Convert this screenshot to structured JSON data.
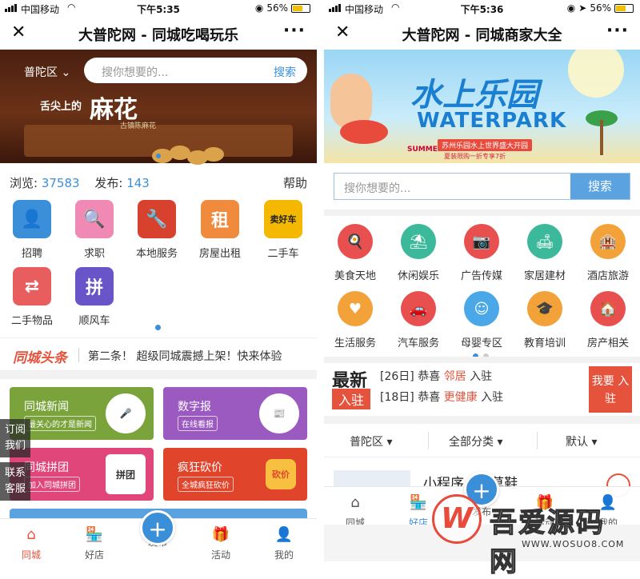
{
  "left": {
    "status": {
      "carrier": "中国移动",
      "time": "下午5:35",
      "battery": "56%"
    },
    "title": "大普陀网 - 同城吃喝玩乐",
    "banner": {
      "district": "普陀区 ⌄",
      "search_placeholder": "搜你想要的...",
      "search_btn": "搜索",
      "slogan": "舌尖上的",
      "product": "麻花",
      "sub": "古镇陈麻花"
    },
    "stats": {
      "views_label": "浏览:",
      "views": "37583",
      "posts_label": "发布:",
      "posts": "143",
      "help": "帮助"
    },
    "categories": [
      {
        "label": "招聘",
        "icon": "👤",
        "color": "#3b8fd8"
      },
      {
        "label": "求职",
        "icon": "🔍",
        "color": "#f08ab5"
      },
      {
        "label": "本地服务",
        "icon": "🔧",
        "color": "#d9412f"
      },
      {
        "label": "房屋出租",
        "icon": "租",
        "color": "#f08a3c"
      },
      {
        "label": "二手车",
        "icon": "卖好车",
        "color": "#f5b800"
      },
      {
        "label": "二手物品",
        "icon": "⇄",
        "color": "#e85d5d"
      },
      {
        "label": "顺风车",
        "icon": "拼",
        "color": "#6a55c8"
      }
    ],
    "headline": {
      "logo": "同城头条",
      "text": "第二条！ 超级同城震撼上架！快来体验"
    },
    "cards": [
      {
        "title": "同城新闻",
        "sub": "最关心的才是新闻",
        "icon": "🎤",
        "color": "#7aa33b"
      },
      {
        "title": "数字报",
        "sub": "在线看报",
        "icon": "📰",
        "color": "#9b5ac0"
      },
      {
        "title": "同城拼团",
        "sub": "加入同城拼团",
        "icon": "拼团",
        "color": "#e0467a"
      },
      {
        "title": "疯狂砍价",
        "sub": "全城疯狂砍价",
        "icon": "砍价",
        "color": "#e0452c"
      }
    ],
    "side": [
      {
        "text": "订阅 我们"
      },
      {
        "text": "联系 客服"
      }
    ],
    "tabs": [
      {
        "label": "同城",
        "icon": "⌂"
      },
      {
        "label": "好店",
        "icon": "🏪"
      },
      {
        "label": "发布",
        "icon": "+"
      },
      {
        "label": "活动",
        "icon": "🎁"
      },
      {
        "label": "我的",
        "icon": "👤"
      }
    ]
  },
  "right": {
    "status": {
      "carrier": "中国移动",
      "time": "下午5:36",
      "battery": "56%"
    },
    "title": "大普陀网 - 同城商家大全",
    "banner": {
      "t1": "水上乐园",
      "t2": "WATERPARK",
      "t3": "苏州乐园水上世界盛大开园",
      "summer": "SUMMER",
      "t4": "夏装限购一折专享7折"
    },
    "search": {
      "placeholder": "搜你想要的...",
      "btn": "搜索"
    },
    "categories": [
      {
        "label": "美食天地",
        "icon": "🍳",
        "color": "#e85050"
      },
      {
        "label": "休闲娱乐",
        "icon": "⛱",
        "color": "#3cb89a"
      },
      {
        "label": "广告传媒",
        "icon": "📷",
        "color": "#e85050"
      },
      {
        "label": "家居建材",
        "icon": "🛋",
        "color": "#3cb89a"
      },
      {
        "label": "酒店旅游",
        "icon": "🏨",
        "color": "#f3a23a"
      },
      {
        "label": "生活服务",
        "icon": "♥",
        "color": "#f3a23a"
      },
      {
        "label": "汽车服务",
        "icon": "🚗",
        "color": "#e85050"
      },
      {
        "label": "母婴专区",
        "icon": "☺",
        "color": "#4aa8e8"
      },
      {
        "label": "教育培训",
        "icon": "🎓",
        "color": "#f3a23a"
      },
      {
        "label": "房产相关",
        "icon": "🏠",
        "color": "#e85050"
      }
    ],
    "news": {
      "big": "最新",
      "tag": "入驻",
      "lines": [
        {
          "date": "[26日]",
          "pre": "恭喜",
          "name": "邻居",
          "post": "入驻"
        },
        {
          "date": "[18日]",
          "pre": "恭喜",
          "name": "更健康",
          "post": "入驻"
        }
      ],
      "join": "我要 入驻"
    },
    "filters": [
      {
        "label": "普陀区 ▾"
      },
      {
        "label": "全部分类 ▾"
      },
      {
        "label": "默认 ▾"
      }
    ],
    "listpeek": {
      "name": "小程序...叶草鞋"
    },
    "tabs": [
      {
        "label": "同城",
        "icon": "⌂"
      },
      {
        "label": "好店",
        "icon": "🏪"
      },
      {
        "label": "发布",
        "icon": "+"
      },
      {
        "label": "活动",
        "icon": "🎁"
      },
      {
        "label": "我的",
        "icon": "👤"
      }
    ]
  },
  "watermark": {
    "logo": "W",
    "text": "吾爱源码网",
    "url": "WWW.WOSUO8.COM"
  },
  "colors": {
    "accent": "#3b8fd8",
    "red": "#e5533c"
  }
}
